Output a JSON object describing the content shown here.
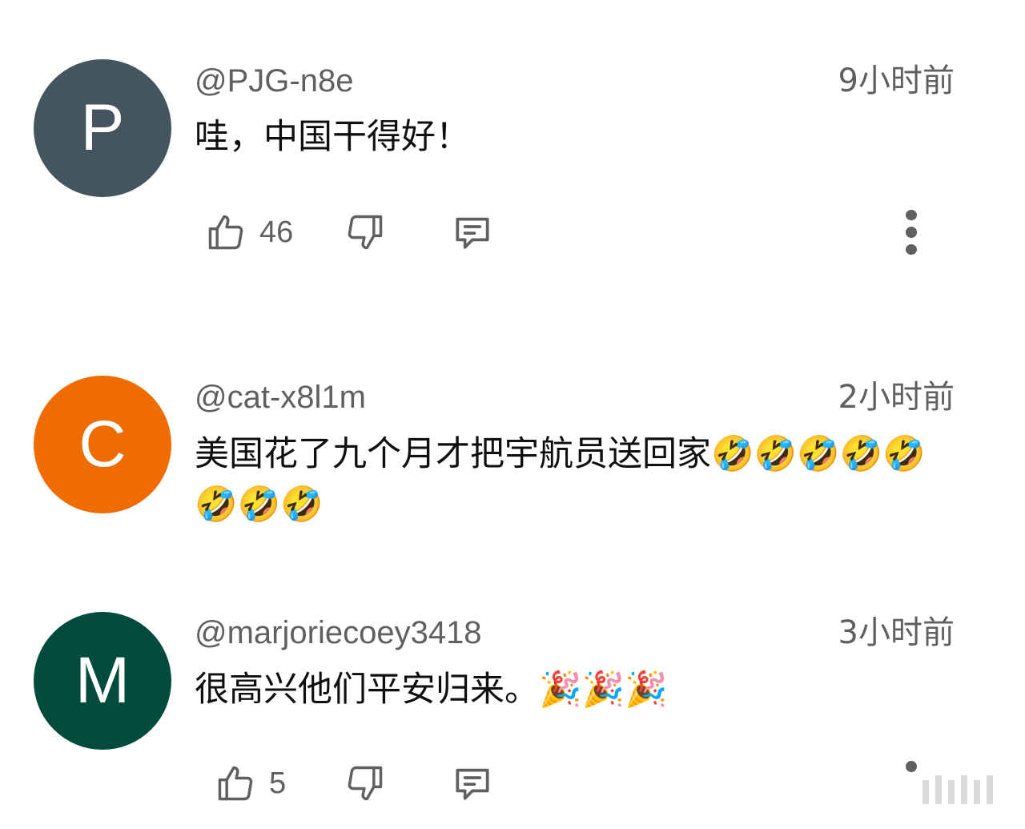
{
  "comments": [
    {
      "avatar_letter": "P",
      "avatar_color": "#44555f",
      "handle": "@PJG-n8e",
      "time": "9小时前",
      "text": "哇，中国干得好！",
      "likes": "46"
    },
    {
      "avatar_letter": "C",
      "avatar_color": "#ef6c00",
      "handle": "@cat-x8l1m",
      "time": "2小时前",
      "text": "美国花了九个月才把宇航员送回家🤣🤣🤣🤣🤣🤣🤣🤣"
    },
    {
      "avatar_letter": "M",
      "avatar_color": "#004b3c",
      "handle": "@marjoriecoey3418",
      "time": "3小时前",
      "text": "很高兴他们平安归来。🎉🎉🎉",
      "likes": "5"
    }
  ],
  "icons": {
    "like": "thumbs-up-icon",
    "dislike": "thumbs-down-icon",
    "reply": "reply-comment-icon",
    "menu": "more-vertical-icon"
  },
  "colors": {
    "icon": "#606060",
    "text": "#0f0f0f",
    "secondary_text": "#606060"
  }
}
